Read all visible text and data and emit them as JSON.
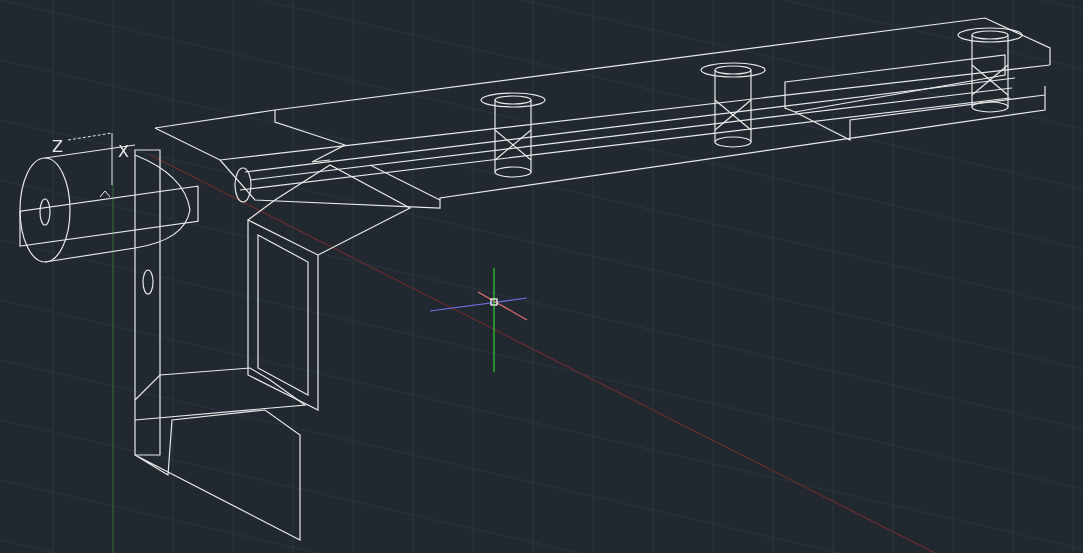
{
  "viewport": {
    "ucs_icon": {
      "z_label": "Z",
      "x_label": "X"
    }
  }
}
